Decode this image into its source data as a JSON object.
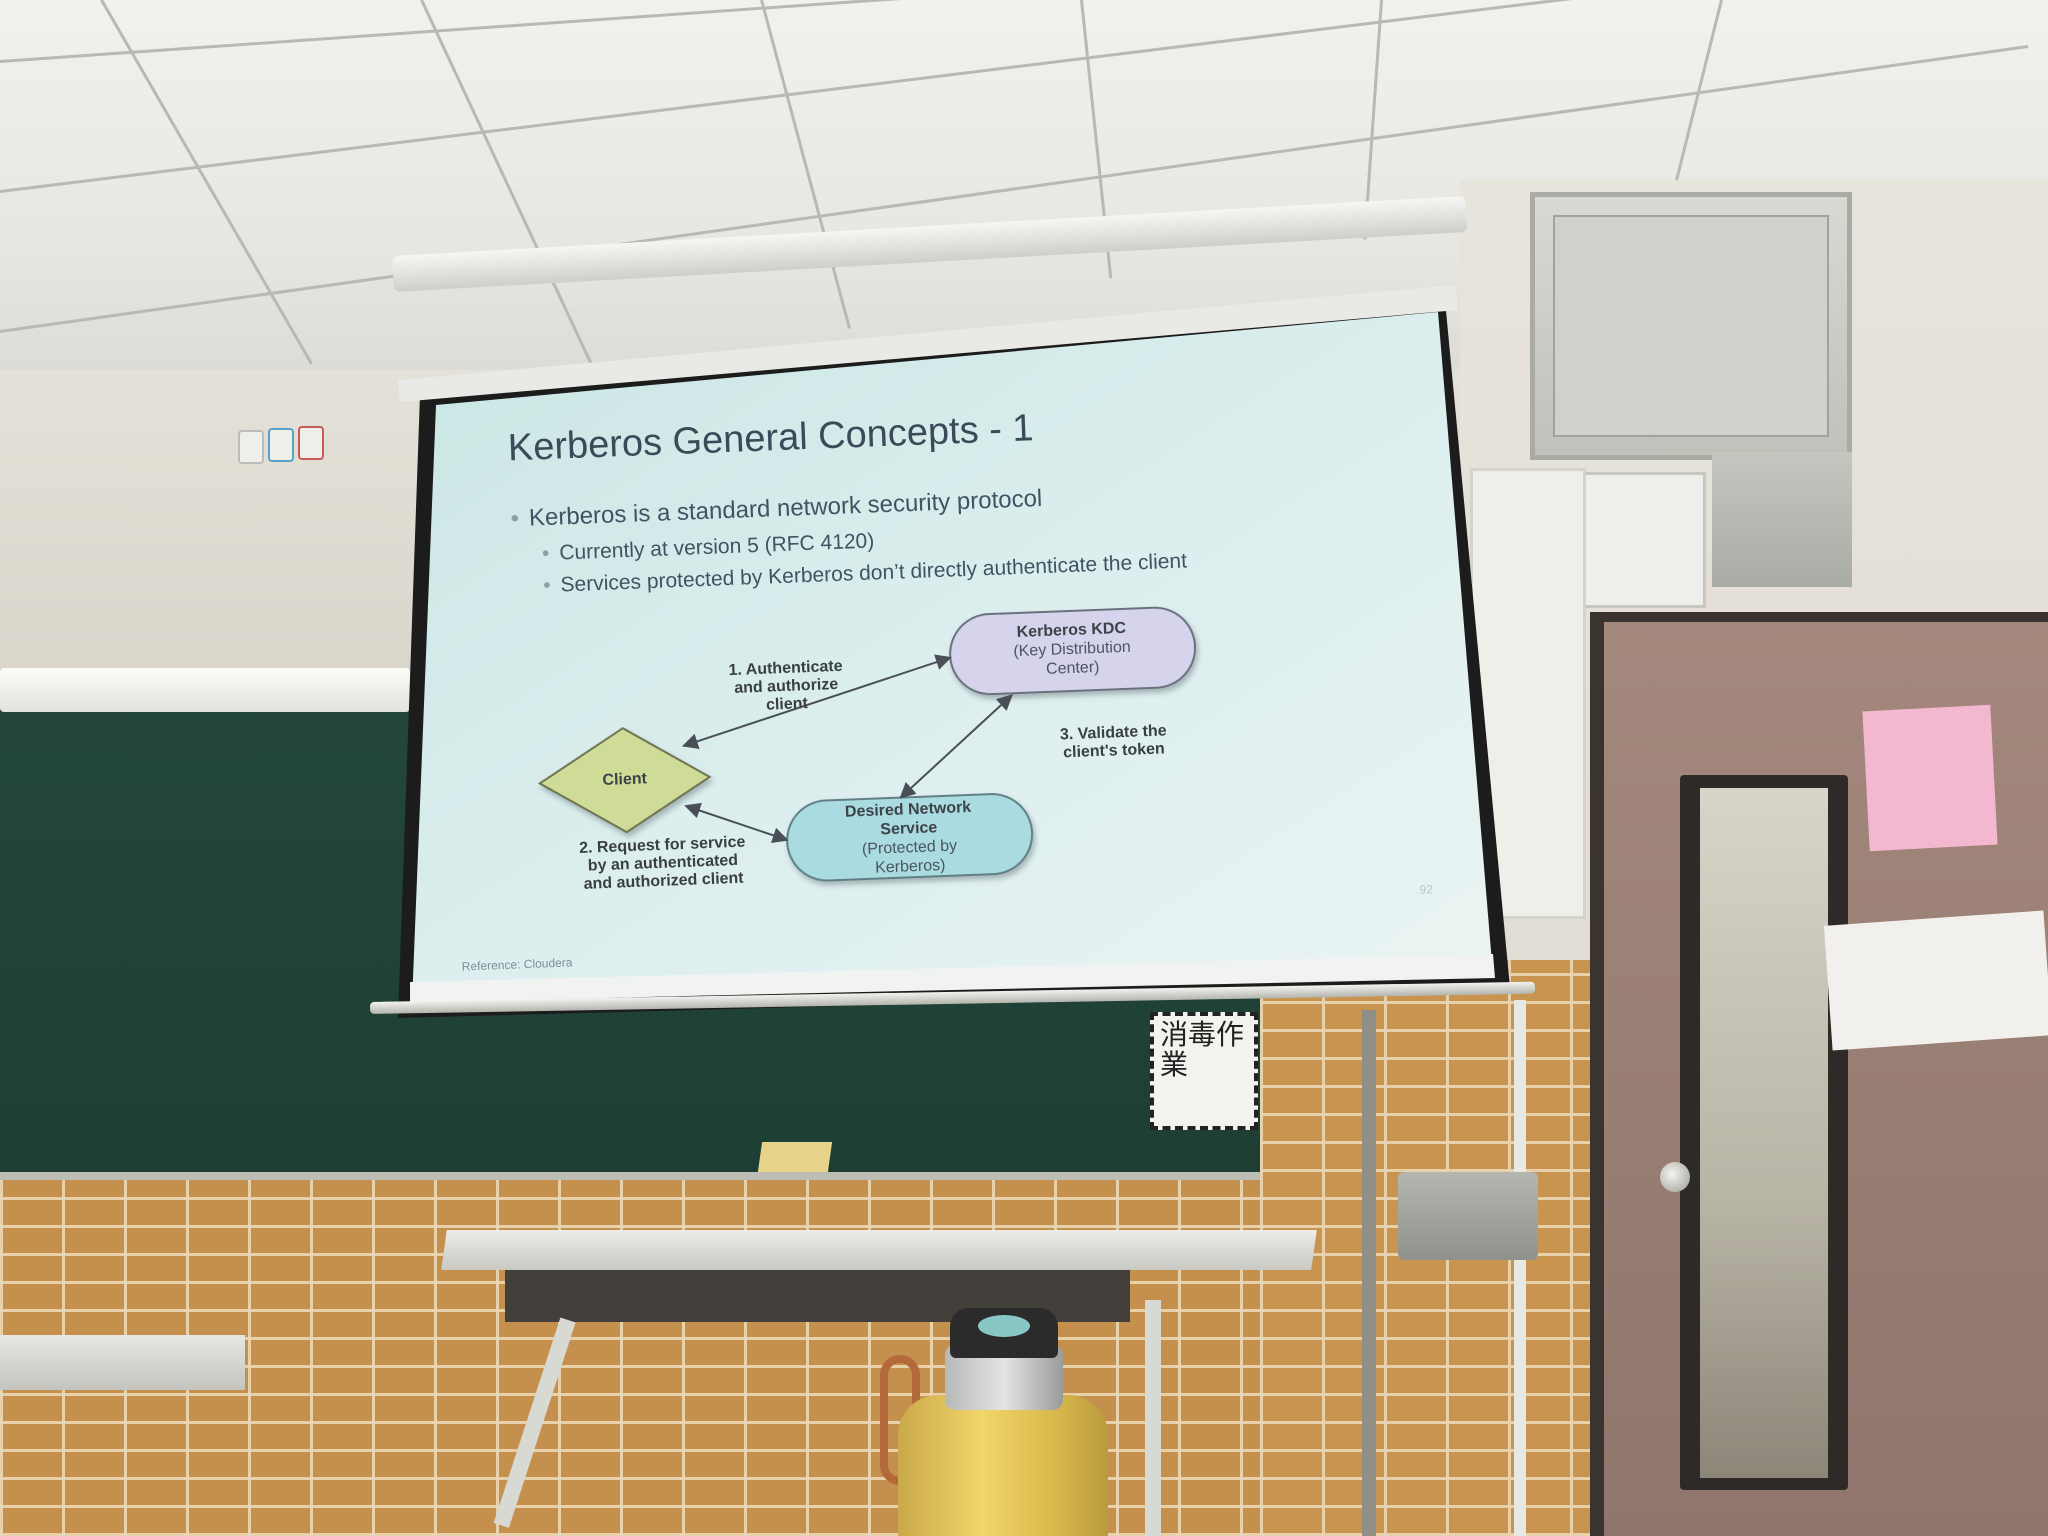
{
  "slide": {
    "title": "Kerberos General Concepts - 1",
    "bullets": {
      "main": "Kerberos is a standard network security protocol",
      "sub1": "Currently at version 5 (RFC 4120)",
      "sub2": "Services protected by Kerberos don’t directly authenticate the client"
    },
    "diagram": {
      "nodes": {
        "kdc_title": "Kerberos KDC",
        "kdc_sub1": "(Key Distribution",
        "kdc_sub2": "Center)",
        "client": "Client",
        "service_title1": "Desired Network",
        "service_title2": "Service",
        "service_sub1": "(Protected by",
        "service_sub2": "Kerberos)"
      },
      "edges": {
        "e1_line1": "1. Authenticate",
        "e1_line2": "and authorize",
        "e1_line3": "client",
        "e2_line1": "2. Request for service",
        "e2_line2": "by an authenticated",
        "e2_line3": "and authorized client",
        "e3_line1": "3. Validate the",
        "e3_line2": "client's token"
      }
    },
    "page_number": "92",
    "reference": "Reference: Cloudera"
  },
  "notice": {
    "drop_sign": "消毒作業"
  },
  "colors": {
    "slide_bg": "#dceeee",
    "kdc_fill": "#d6d3ec",
    "client_fill": "#cfdc98",
    "service_fill": "#a9dbe0",
    "chalkboard": "#22453a"
  }
}
